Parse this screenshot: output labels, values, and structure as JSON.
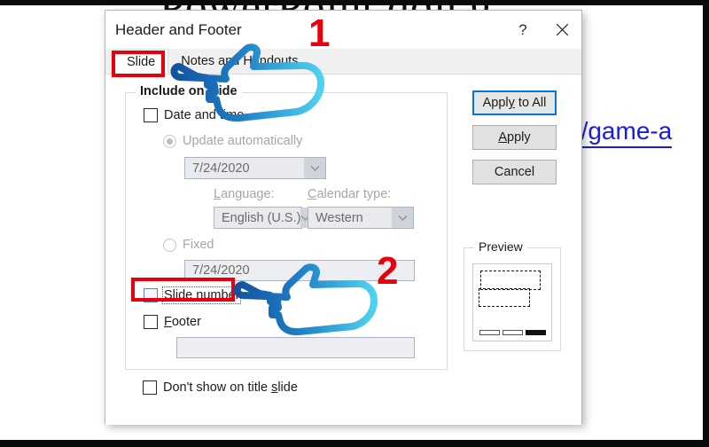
{
  "background": {
    "title_text": "PowerPoint đơn g",
    "link_text": "n/game-a"
  },
  "dialog": {
    "title": "Header and Footer",
    "help_icon": "question-mark-icon",
    "close_icon": "close-icon",
    "tabs": [
      {
        "label": "Slide",
        "active": true
      },
      {
        "label": "Notes and Handouts",
        "active": false
      }
    ],
    "include_group": {
      "legend": "Include on slide",
      "date_and_time": {
        "label": "Date and time",
        "checked": false
      },
      "update_automatically": {
        "label": "Update automatically",
        "selected": true,
        "date_value": "7/24/2020",
        "language_label": "Language:",
        "language_value": "English (U.S.)",
        "calendar_label": "Calendar type:",
        "calendar_value": "Western"
      },
      "fixed": {
        "label": "Fixed",
        "selected": false,
        "value": "7/24/2020"
      },
      "slide_number": {
        "label": "Slide number",
        "checked": false
      },
      "footer": {
        "label": "Footer",
        "checked": false,
        "value": ""
      }
    },
    "dont_show_on_title_slide": {
      "label": "Don't show on title slide",
      "checked": false
    },
    "buttons": [
      {
        "label": "Apply to All",
        "default": true
      },
      {
        "label": "Apply",
        "default": false
      },
      {
        "label": "Cancel",
        "default": false
      }
    ],
    "preview": {
      "legend": "Preview"
    }
  },
  "annotations": {
    "step_one": "1",
    "step_two": "2",
    "accent_color": "#e8000d",
    "hand_color": "#1f6fc4"
  }
}
